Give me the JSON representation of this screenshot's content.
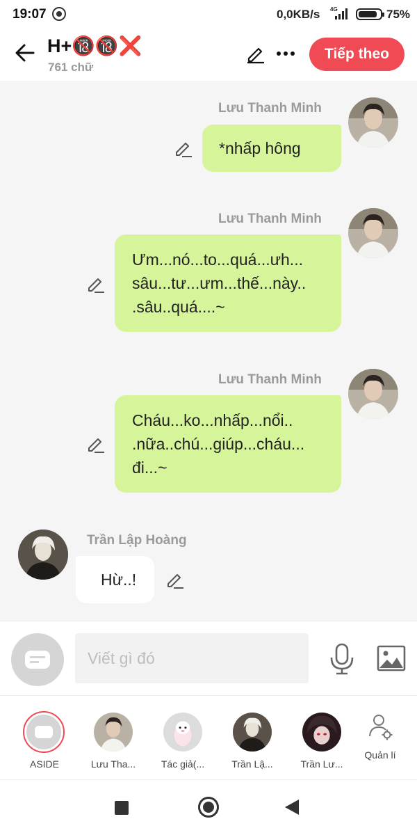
{
  "status_bar": {
    "time": "19:07",
    "network_speed": "0,0KB/s",
    "network_type": "4G",
    "battery": "75%",
    "icons": [
      "clock-icon",
      "signal-icon",
      "battery-icon"
    ]
  },
  "header": {
    "title": "H+🔞🔞❌",
    "word_count": "761 chữ",
    "next_button": "Tiếp theo",
    "accent_color": "#f04a55",
    "icons": [
      "back-arrow-icon",
      "pencil-icon",
      "more-icon"
    ]
  },
  "messages": [
    {
      "sender": "Lưu Thanh Minh",
      "side": "right",
      "lines": [
        "*nhấp hông"
      ]
    },
    {
      "sender": "Lưu Thanh Minh",
      "side": "right",
      "lines": [
        "Ưm...nó...to...quá...ưh...",
        "sâu...tư...ưm...thế...này..",
        ".sâu..quá....~"
      ]
    },
    {
      "sender": "Lưu Thanh Minh",
      "side": "right",
      "lines": [
        "Cháu...ko...nhấp...nổi..",
        ".nữa..chú...giúp...cháu...",
        "đi...~"
      ]
    },
    {
      "sender": "Trần Lập Hoàng",
      "side": "left",
      "lines": [
        "Hừ..!"
      ]
    }
  ],
  "input_bar": {
    "placeholder": "Viết gì đó",
    "icons": [
      "chat-bubble-icon",
      "microphone-icon",
      "image-icon"
    ]
  },
  "characters": [
    {
      "label": "ASIDE"
    },
    {
      "label": "Lưu Tha..."
    },
    {
      "label": "Tác giả(..."
    },
    {
      "label": "Trần Lậ..."
    },
    {
      "label": "Trần Lư..."
    }
  ],
  "manage": {
    "label": "Quản lí",
    "icon": "user-settings-icon"
  },
  "colors": {
    "right_bubble": "#d6f59a",
    "left_bubble": "#ffffff",
    "chat_background": "#f5f5f5"
  }
}
